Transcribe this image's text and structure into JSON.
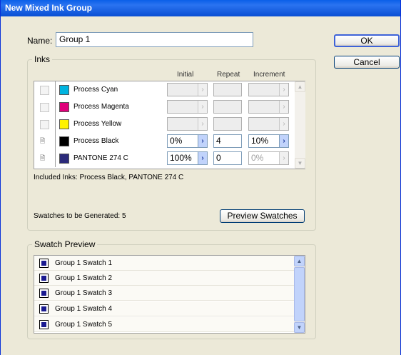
{
  "window": {
    "title": "New Mixed Ink Group"
  },
  "name_field": {
    "label": "Name:",
    "value": "Group 1"
  },
  "buttons": {
    "ok": "OK",
    "cancel": "Cancel",
    "preview": "Preview Swatches"
  },
  "inks": {
    "group_title": "Inks",
    "columns": {
      "initial": "Initial",
      "repeat": "Repeat",
      "increment": "Increment"
    },
    "rows": [
      {
        "name": "Process Cyan",
        "color": "#00B4E0",
        "checked": false,
        "initial": "",
        "repeat": "",
        "increment": ""
      },
      {
        "name": "Process Magenta",
        "color": "#E0007A",
        "checked": false,
        "initial": "",
        "repeat": "",
        "increment": ""
      },
      {
        "name": "Process Yellow",
        "color": "#FFF200",
        "checked": false,
        "initial": "",
        "repeat": "",
        "increment": ""
      },
      {
        "name": "Process Black",
        "color": "#000000",
        "checked": true,
        "initial": "0%",
        "repeat": "4",
        "increment": "10%"
      },
      {
        "name": "PANTONE 274 C",
        "color": "#2B2A7A",
        "checked": true,
        "initial": "100%",
        "repeat": "0",
        "increment": "0%"
      }
    ],
    "included": "Included Inks: Process Black, PANTONE 274 C",
    "swatches_generated": "Swatches to be Generated: 5"
  },
  "preview": {
    "group_title": "Swatch Preview",
    "swatch_color": "#1A1A90",
    "items": [
      "Group 1 Swatch 1",
      "Group 1 Swatch 2",
      "Group 1 Swatch 3",
      "Group 1 Swatch 4",
      "Group 1 Swatch 5"
    ]
  },
  "icons": {
    "checked_ink": "ink-included-icon",
    "arrow": "chevron-right-icon",
    "scroll_up": "scroll-up-icon",
    "scroll_down": "scroll-down-icon"
  }
}
